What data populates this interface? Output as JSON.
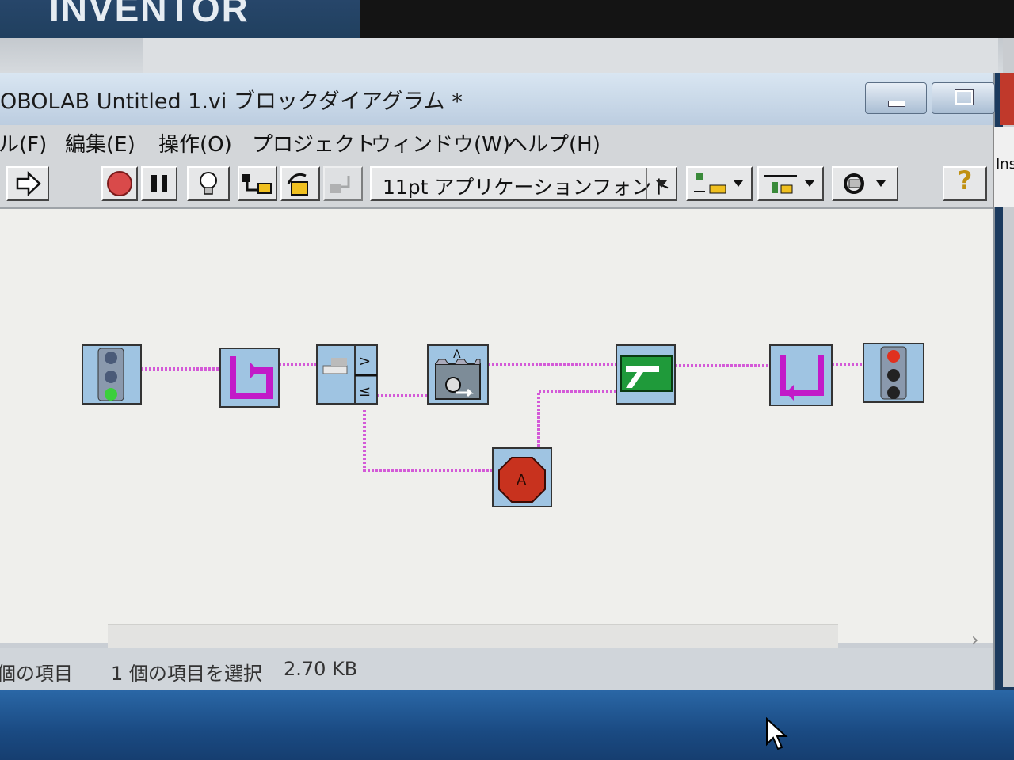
{
  "banner": {
    "brand": "INVENTOR"
  },
  "window": {
    "title": "OBOLAB Untitled 1.vi ブロックダイアグラム *"
  },
  "menu": {
    "items": [
      {
        "label": "ル(F)"
      },
      {
        "label": "編集(E)"
      },
      {
        "label": "操作(O)"
      },
      {
        "label": "プロジェクト"
      },
      {
        "label": "ウィンドウ(W)"
      },
      {
        "label": "ヘルプ(H)"
      }
    ]
  },
  "toolbar": {
    "font_select": "11pt アプリケーションフォント",
    "help_glyph": "?"
  },
  "side_panel": {
    "text": "Ins"
  },
  "diagram": {
    "blocks": [
      {
        "name": "begin-traffic-light-icon"
      },
      {
        "name": "loop-start-icon"
      },
      {
        "name": "touch-sensor-fork-icon",
        "labels": [
          ">",
          "≤"
        ]
      },
      {
        "name": "wait-for-sensor-icon",
        "label": "A"
      },
      {
        "name": "stop-motor-a-icon",
        "label": "A"
      },
      {
        "name": "green-block-icon"
      },
      {
        "name": "loop-end-icon"
      },
      {
        "name": "end-traffic-light-icon"
      }
    ],
    "wire_color": "#d05ad8"
  },
  "status": {
    "left": "個の項目",
    "selected": "1 個の項目を選択",
    "size": "2.70 KB"
  }
}
